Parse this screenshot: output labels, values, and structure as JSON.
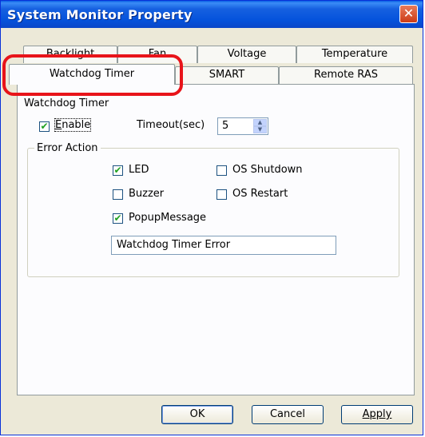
{
  "window": {
    "title": "System Monitor Property",
    "close_label": "✕"
  },
  "tabs": {
    "row_back": [
      "Backlight",
      "Fan",
      "Voltage",
      "Temperature"
    ],
    "row_front": [
      "Watchdog Timer",
      "SMART",
      "Remote RAS"
    ],
    "active": "Watchdog Timer"
  },
  "watchdog": {
    "section_label": "Watchdog Timer",
    "enable_label": "Enable",
    "enable_checked": true,
    "timeout_label": "Timeout(sec)",
    "timeout_value": "5"
  },
  "error_action": {
    "group_label": "Error Action",
    "led_label": "LED",
    "led_checked": true,
    "buzzer_label": "Buzzer",
    "buzzer_checked": false,
    "popup_label": "PopupMessage",
    "popup_checked": true,
    "os_shutdown_label": "OS Shutdown",
    "os_shutdown_checked": false,
    "os_restart_label": "OS Restart",
    "os_restart_checked": false,
    "message_value": "Watchdog Timer Error"
  },
  "buttons": {
    "ok": "OK",
    "cancel": "Cancel",
    "apply": "Apply"
  },
  "colors": {
    "titlebar": "#0553dc",
    "highlight": "#e8141a",
    "window_bg": "#ece9d8",
    "check": "#21a121"
  }
}
